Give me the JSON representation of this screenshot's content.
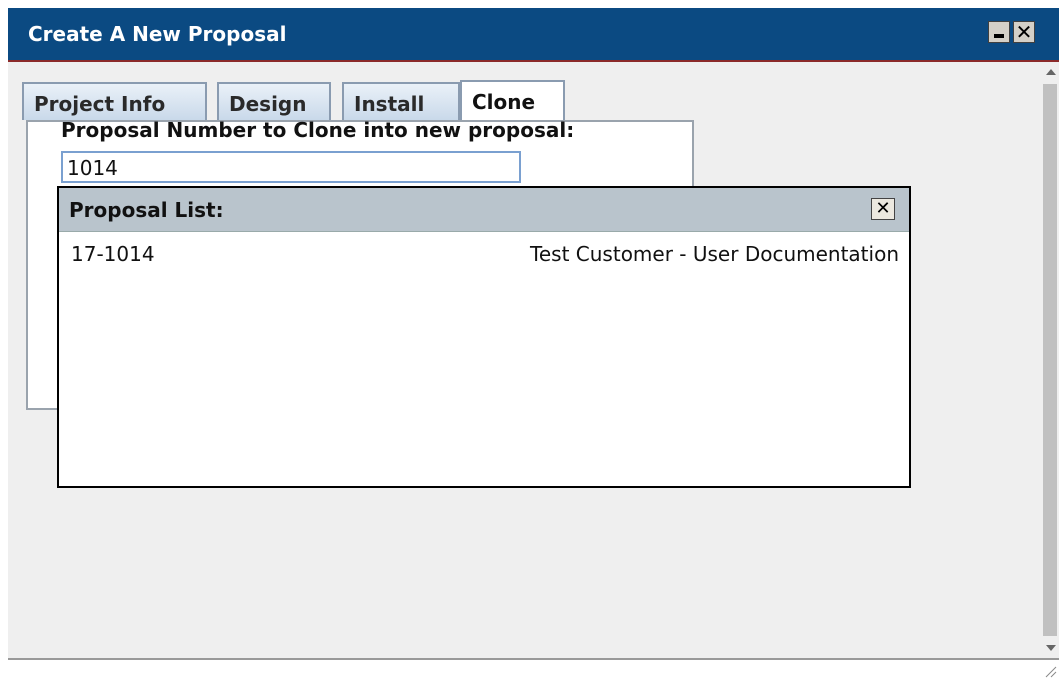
{
  "window": {
    "title": "Create A New Proposal",
    "minimize_glyph": "",
    "close_glyph": "✕"
  },
  "tabs": [
    {
      "label": "Project Info",
      "active": false
    },
    {
      "label": "Design",
      "active": false
    },
    {
      "label": "Install",
      "active": false
    },
    {
      "label": "Clone",
      "active": true
    }
  ],
  "clone_panel": {
    "field_label": "Proposal Number to Clone into new proposal:",
    "field_value": "1014"
  },
  "proposal_list": {
    "title": "Proposal List:",
    "close_glyph": "✕",
    "items": [
      {
        "id": "17-1014",
        "description": "Test Customer - User Documentation"
      }
    ]
  },
  "colors": {
    "title_bar": "#0b4a82",
    "popup_header": "#b9c4cc",
    "field_border": "#7aa0d0"
  }
}
